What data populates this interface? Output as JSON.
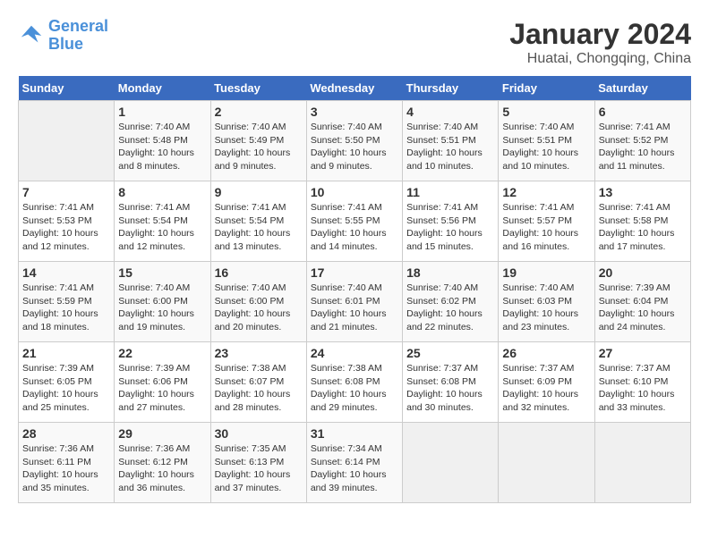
{
  "logo": {
    "line1": "General",
    "line2": "Blue"
  },
  "title": "January 2024",
  "location": "Huatai, Chongqing, China",
  "days_of_week": [
    "Sunday",
    "Monday",
    "Tuesday",
    "Wednesday",
    "Thursday",
    "Friday",
    "Saturday"
  ],
  "weeks": [
    [
      {
        "day": "",
        "info": ""
      },
      {
        "day": "1",
        "info": "Sunrise: 7:40 AM\nSunset: 5:48 PM\nDaylight: 10 hours\nand 8 minutes."
      },
      {
        "day": "2",
        "info": "Sunrise: 7:40 AM\nSunset: 5:49 PM\nDaylight: 10 hours\nand 9 minutes."
      },
      {
        "day": "3",
        "info": "Sunrise: 7:40 AM\nSunset: 5:50 PM\nDaylight: 10 hours\nand 9 minutes."
      },
      {
        "day": "4",
        "info": "Sunrise: 7:40 AM\nSunset: 5:51 PM\nDaylight: 10 hours\nand 10 minutes."
      },
      {
        "day": "5",
        "info": "Sunrise: 7:40 AM\nSunset: 5:51 PM\nDaylight: 10 hours\nand 10 minutes."
      },
      {
        "day": "6",
        "info": "Sunrise: 7:41 AM\nSunset: 5:52 PM\nDaylight: 10 hours\nand 11 minutes."
      }
    ],
    [
      {
        "day": "7",
        "info": "Sunrise: 7:41 AM\nSunset: 5:53 PM\nDaylight: 10 hours\nand 12 minutes."
      },
      {
        "day": "8",
        "info": "Sunrise: 7:41 AM\nSunset: 5:54 PM\nDaylight: 10 hours\nand 12 minutes."
      },
      {
        "day": "9",
        "info": "Sunrise: 7:41 AM\nSunset: 5:54 PM\nDaylight: 10 hours\nand 13 minutes."
      },
      {
        "day": "10",
        "info": "Sunrise: 7:41 AM\nSunset: 5:55 PM\nDaylight: 10 hours\nand 14 minutes."
      },
      {
        "day": "11",
        "info": "Sunrise: 7:41 AM\nSunset: 5:56 PM\nDaylight: 10 hours\nand 15 minutes."
      },
      {
        "day": "12",
        "info": "Sunrise: 7:41 AM\nSunset: 5:57 PM\nDaylight: 10 hours\nand 16 minutes."
      },
      {
        "day": "13",
        "info": "Sunrise: 7:41 AM\nSunset: 5:58 PM\nDaylight: 10 hours\nand 17 minutes."
      }
    ],
    [
      {
        "day": "14",
        "info": "Sunrise: 7:41 AM\nSunset: 5:59 PM\nDaylight: 10 hours\nand 18 minutes."
      },
      {
        "day": "15",
        "info": "Sunrise: 7:40 AM\nSunset: 6:00 PM\nDaylight: 10 hours\nand 19 minutes."
      },
      {
        "day": "16",
        "info": "Sunrise: 7:40 AM\nSunset: 6:00 PM\nDaylight: 10 hours\nand 20 minutes."
      },
      {
        "day": "17",
        "info": "Sunrise: 7:40 AM\nSunset: 6:01 PM\nDaylight: 10 hours\nand 21 minutes."
      },
      {
        "day": "18",
        "info": "Sunrise: 7:40 AM\nSunset: 6:02 PM\nDaylight: 10 hours\nand 22 minutes."
      },
      {
        "day": "19",
        "info": "Sunrise: 7:40 AM\nSunset: 6:03 PM\nDaylight: 10 hours\nand 23 minutes."
      },
      {
        "day": "20",
        "info": "Sunrise: 7:39 AM\nSunset: 6:04 PM\nDaylight: 10 hours\nand 24 minutes."
      }
    ],
    [
      {
        "day": "21",
        "info": "Sunrise: 7:39 AM\nSunset: 6:05 PM\nDaylight: 10 hours\nand 25 minutes."
      },
      {
        "day": "22",
        "info": "Sunrise: 7:39 AM\nSunset: 6:06 PM\nDaylight: 10 hours\nand 27 minutes."
      },
      {
        "day": "23",
        "info": "Sunrise: 7:38 AM\nSunset: 6:07 PM\nDaylight: 10 hours\nand 28 minutes."
      },
      {
        "day": "24",
        "info": "Sunrise: 7:38 AM\nSunset: 6:08 PM\nDaylight: 10 hours\nand 29 minutes."
      },
      {
        "day": "25",
        "info": "Sunrise: 7:37 AM\nSunset: 6:08 PM\nDaylight: 10 hours\nand 30 minutes."
      },
      {
        "day": "26",
        "info": "Sunrise: 7:37 AM\nSunset: 6:09 PM\nDaylight: 10 hours\nand 32 minutes."
      },
      {
        "day": "27",
        "info": "Sunrise: 7:37 AM\nSunset: 6:10 PM\nDaylight: 10 hours\nand 33 minutes."
      }
    ],
    [
      {
        "day": "28",
        "info": "Sunrise: 7:36 AM\nSunset: 6:11 PM\nDaylight: 10 hours\nand 35 minutes."
      },
      {
        "day": "29",
        "info": "Sunrise: 7:36 AM\nSunset: 6:12 PM\nDaylight: 10 hours\nand 36 minutes."
      },
      {
        "day": "30",
        "info": "Sunrise: 7:35 AM\nSunset: 6:13 PM\nDaylight: 10 hours\nand 37 minutes."
      },
      {
        "day": "31",
        "info": "Sunrise: 7:34 AM\nSunset: 6:14 PM\nDaylight: 10 hours\nand 39 minutes."
      },
      {
        "day": "",
        "info": ""
      },
      {
        "day": "",
        "info": ""
      },
      {
        "day": "",
        "info": ""
      }
    ]
  ]
}
